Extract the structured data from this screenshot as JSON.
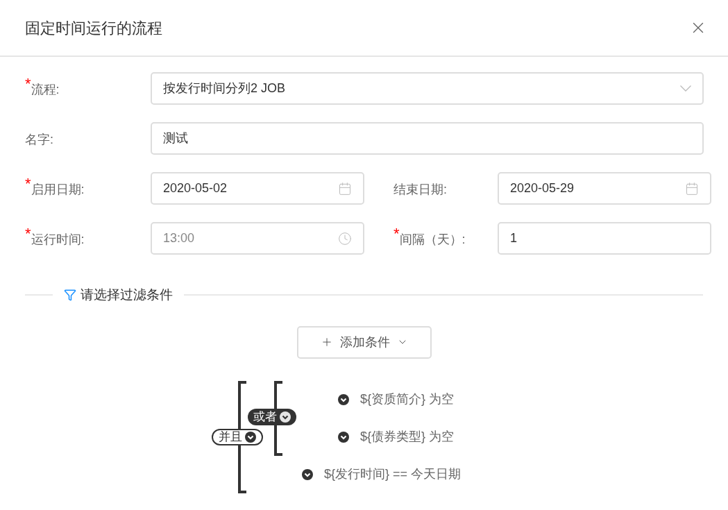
{
  "dialog": {
    "title": "固定时间运行的流程"
  },
  "form": {
    "rows": [
      [
        {
          "mark": "*",
          "label": "流程:",
          "kind": "select",
          "value": "按发行时间分列2 JOB"
        }
      ],
      [
        {
          "label": "名字:",
          "kind": "text",
          "value": "测试"
        }
      ],
      [
        {
          "mark": "*",
          "label": "启用日期:",
          "kind": "date",
          "value": "2020-05-02"
        },
        {
          "label": "结束日期:",
          "kind": "date",
          "value": "2020-05-29"
        }
      ],
      [
        {
          "mark": "*",
          "label": "运行时间:",
          "kind": "time",
          "placeholder": "13:00"
        },
        {
          "mark": "*",
          "label": "间隔（天）:",
          "kind": "text",
          "value": "1"
        }
      ]
    ]
  },
  "filter": {
    "divider_label": "请选择过滤条件",
    "add_button": "添加条件",
    "tree": {
      "operator": "并且",
      "children": [
        {
          "kind": "group",
          "operator": "或者",
          "children": [
            {
              "kind": "condition",
              "text": "${资质简介} 为空"
            },
            {
              "kind": "condition",
              "text": "${债券类型} 为空"
            }
          ]
        },
        {
          "kind": "condition",
          "text": "${发行时间} == 今天日期"
        }
      ]
    }
  }
}
